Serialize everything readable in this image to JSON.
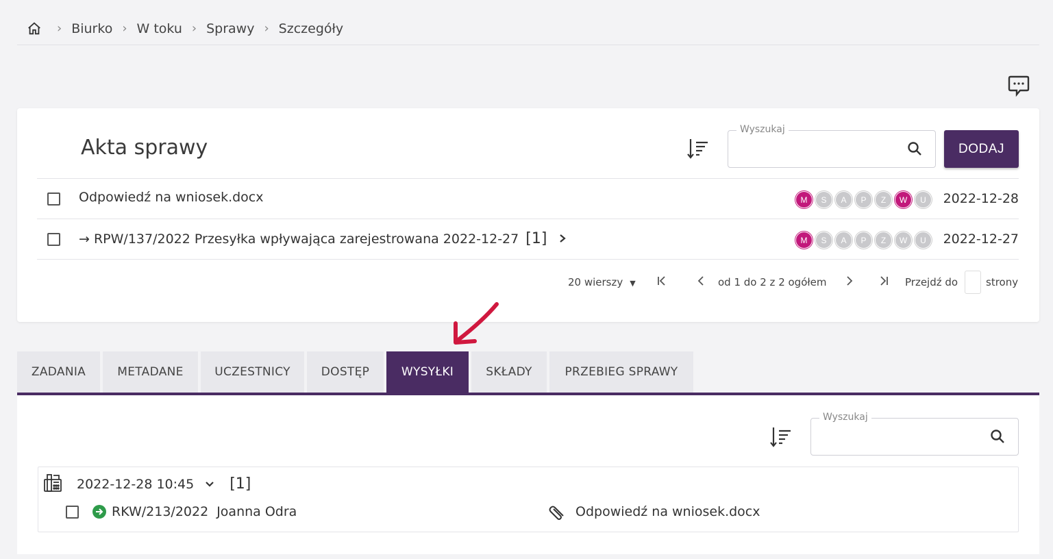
{
  "breadcrumb": {
    "items": [
      "Biurko",
      "W toku",
      "Sprawy",
      "Szczegóły"
    ]
  },
  "acts": {
    "title": "Akta sprawy",
    "search_label": "Wyszukaj",
    "add_label": "DODAJ",
    "rows": [
      {
        "name": "Odpowiedź na wniosek.docx",
        "date": "2022-12-28",
        "badges": [
          "M",
          "S",
          "A",
          "P",
          "Z",
          "W",
          "U"
        ],
        "active": [
          true,
          false,
          false,
          false,
          false,
          true,
          false
        ]
      },
      {
        "prefix": "→",
        "ref": "RPW/137/2022",
        "name": "Przesyłka wpływająca zarejestrowana 2022-12-27",
        "count": "[1]",
        "date": "2022-12-27",
        "badges": [
          "M",
          "S",
          "A",
          "P",
          "Z",
          "W",
          "U"
        ],
        "active": [
          true,
          false,
          false,
          false,
          false,
          false,
          false
        ]
      }
    ],
    "pager": {
      "rows_label": "20 wierszy",
      "range": "od 1 do 2 z 2 ogółem",
      "goto_label": "Przejdź do",
      "pages_label": "strony"
    }
  },
  "tabs": [
    "ZADANIA",
    "METADANE",
    "UCZESTNICY",
    "DOSTĘP",
    "WYSYŁKI",
    "SKŁADY",
    "PRZEBIEG SPRAWY"
  ],
  "active_tab": "WYSYŁKI",
  "shipments": {
    "search_label": "Wyszukaj",
    "group": {
      "datetime": "2022-12-28 10:45",
      "count": "[1]",
      "item": {
        "ref": "RKW/213/2022",
        "person": "Joanna Odra",
        "attachment": "Odpowiedź na wniosek.docx"
      }
    }
  },
  "colors": {
    "accent": "#4a2c63",
    "badge_on": "#c2187b",
    "badge_off": "#c9c9cc",
    "status_green": "#2e9b4a",
    "arrow": "#d0183f"
  }
}
